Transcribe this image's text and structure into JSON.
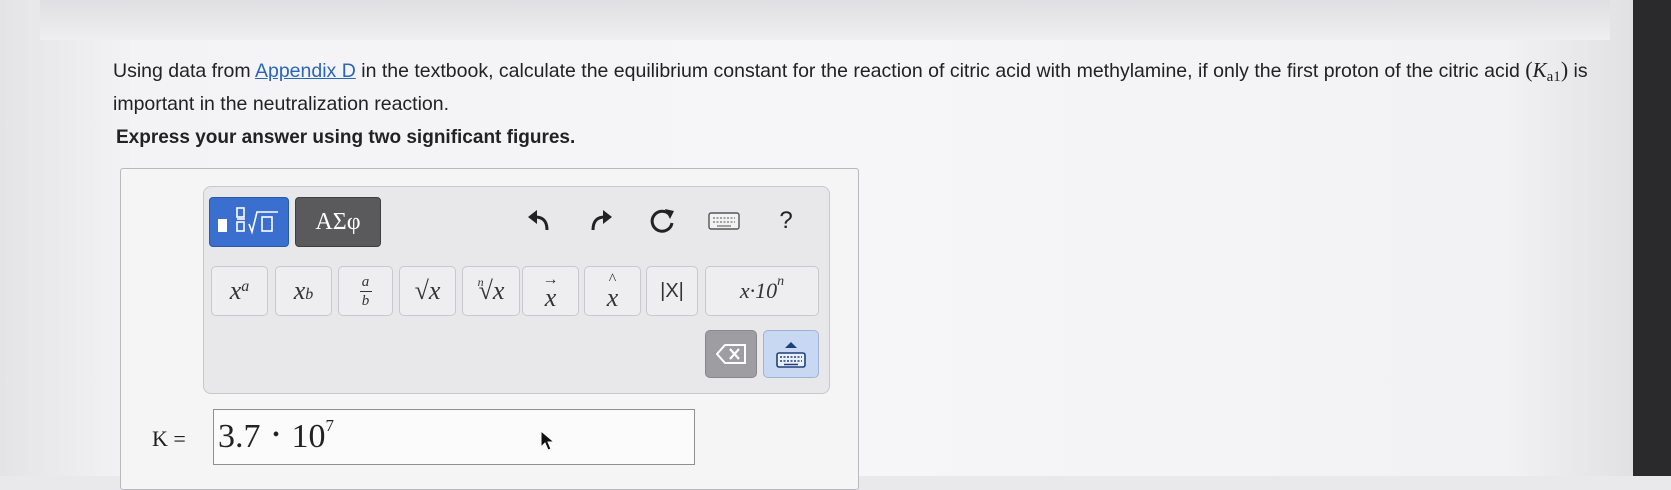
{
  "question": {
    "text_before_link": "Using data from ",
    "link_text": "Appendix D",
    "text_after_link": " in the textbook, calculate the equilibrium constant for the reaction of citric acid with methylamine, if only the first proton of the citric acid ",
    "ka_symbol": "K",
    "ka_subscript": "a1",
    "text_end": " is important in the neutralization reaction."
  },
  "instruction": "Express your answer using two significant figures.",
  "toolbar": {
    "greek_label": "ΑΣφ",
    "help_label": "?",
    "keys": [
      {
        "name": "superscript",
        "base": "x",
        "script": "a"
      },
      {
        "name": "subscript",
        "base": "x",
        "script": "b"
      },
      {
        "name": "fraction",
        "numerator": "a",
        "denominator": "b"
      },
      {
        "name": "square-root",
        "label": "√x"
      },
      {
        "name": "nth-root",
        "index": "n",
        "label": "√x"
      },
      {
        "name": "vector",
        "label": "x",
        "accent": "→"
      },
      {
        "name": "unit-vector",
        "label": "x",
        "accent": "^"
      },
      {
        "name": "absolute-value",
        "label": "|X|"
      },
      {
        "name": "scientific-notation",
        "label": "x·10",
        "exponent": "n"
      }
    ]
  },
  "answer": {
    "label": "K =",
    "mantissa": "3.7",
    "separator": "•",
    "base": "10",
    "exponent": "7"
  },
  "colors": {
    "template_button": "#3a6fd0",
    "greek_button": "#5a5a5d",
    "link": "#2a66b4",
    "keyboard_button": "#c8d8f2"
  }
}
